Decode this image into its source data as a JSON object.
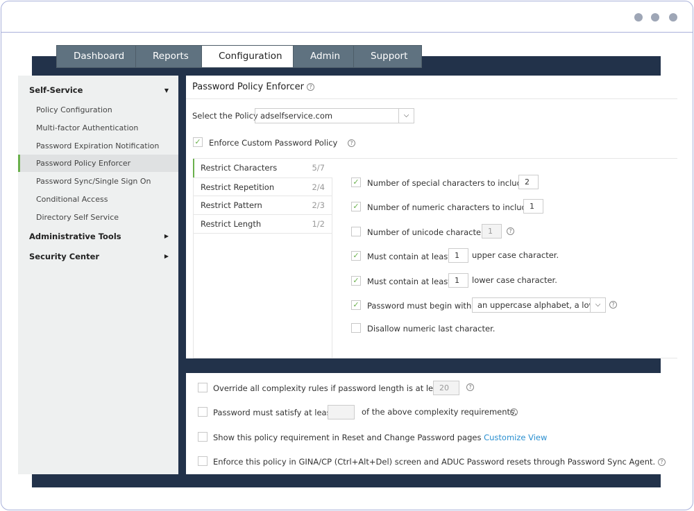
{
  "tabs": [
    "Dashboard",
    "Reports",
    "Configuration",
    "Admin",
    "Support"
  ],
  "active_tab": "Configuration",
  "sidebar": {
    "self_service": "Self-Service",
    "items": [
      "Policy Configuration",
      "Multi-factor Authentication",
      "Password Expiration Notification",
      "Password Policy Enforcer",
      "Password Sync/Single Sign On",
      "Conditional Access",
      "Directory Self Service"
    ],
    "active": "Password Policy Enforcer",
    "admin_tools": "Administrative Tools",
    "security_center": "Security Center"
  },
  "main": {
    "title": "Password Policy Enforcer",
    "select_label": "Select the Policy",
    "select_value": "adselfservice.com",
    "enforce_label": "Enforce Custom Password Policy",
    "enforce_checked": true,
    "rule_tabs": [
      {
        "label": "Restrict Characters",
        "count": "5/7"
      },
      {
        "label": "Restrict Repetition",
        "count": "2/4"
      },
      {
        "label": "Restrict Pattern",
        "count": "2/3"
      },
      {
        "label": "Restrict Length",
        "count": "1/2"
      }
    ],
    "rules": {
      "special": {
        "label": "Number of special characters to include",
        "value": "2",
        "checked": true
      },
      "numeric": {
        "label": "Number of numeric characters to include",
        "value": "1",
        "checked": true
      },
      "unicode": {
        "label": "Number of unicode characters",
        "value": "1",
        "checked": false
      },
      "upper": {
        "label": "Must contain at least",
        "value": "1",
        "suffix": "upper case character.",
        "checked": true
      },
      "lower": {
        "label": "Must contain at least",
        "value": "1",
        "suffix": "lower case character.",
        "checked": true
      },
      "begin": {
        "label": "Password must begin with",
        "value": "an uppercase alphabet, a lowe",
        "checked": true
      },
      "last": {
        "label": "Disallow numeric last character.",
        "checked": false
      }
    }
  },
  "bottom": {
    "override": {
      "label": "Override all complexity rules if password length is at least",
      "value": "20"
    },
    "satisfy": {
      "label": "Password must satisfy at least",
      "value": "",
      "suffix": "of the above complexity requirements."
    },
    "show": {
      "label": "Show this policy requirement in Reset and Change Password pages",
      "link": "Customize View"
    },
    "gina": {
      "label": "Enforce this policy in GINA/CP (Ctrl+Alt+Del) screen and ADUC Password resets through Password Sync Agent."
    }
  },
  "colors": {
    "navy": "#22324a",
    "tab": "#5f7280",
    "accent": "#6ab04c",
    "link": "#2a8fd0"
  }
}
